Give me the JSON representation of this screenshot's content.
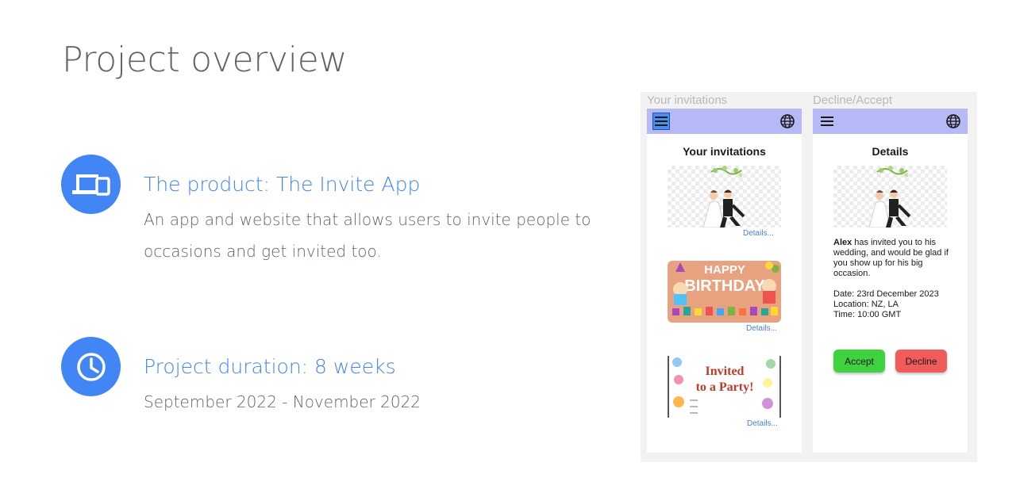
{
  "page": {
    "title": "Project overview"
  },
  "product": {
    "heading": "The product: The Invite App",
    "description": "An app and website that allows users to invite people to occasions and get invited too.",
    "icon": "devices-icon"
  },
  "duration": {
    "heading": "Project duration: 8 weeks",
    "dates": "September 2022 - November 2022",
    "icon": "clock-icon"
  },
  "mockup": {
    "left_screen": {
      "caption": "Your invitations",
      "title": "Your invitations",
      "cards": [
        {
          "link": "Details..."
        },
        {
          "link": "Details...",
          "art_text_1": "HAPPY",
          "art_text_2": "BIRTHDAY"
        },
        {
          "link": "Details...",
          "art_text_1": "Invited",
          "art_text_2": "to a Party!"
        }
      ]
    },
    "right_screen": {
      "caption": "Decline/Accept",
      "title": "Details",
      "invite_name": "Alex",
      "invite_message": " has invited you to his wedding, and would be glad if you show up for his big occasion.",
      "date": "Date: 23rd December 2023",
      "location": "Location: NZ, LA",
      "time": "Time: 10:00 GMT",
      "accept_label": "Accept",
      "decline_label": "Decline"
    }
  },
  "colors": {
    "accent": "#4285f4",
    "text": "#5f6368",
    "appbar": "#b5b9f5",
    "accept": "#3fd13f",
    "decline": "#f05b5b"
  }
}
